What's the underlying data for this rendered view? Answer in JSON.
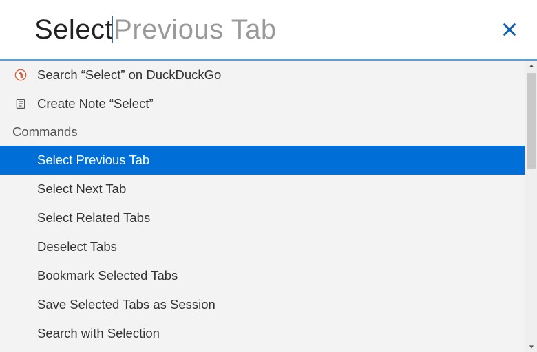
{
  "search": {
    "typed": "Select",
    "suggestion_remainder": " Previous Tab"
  },
  "close_label": "Close",
  "actions": [
    {
      "icon": "duckduckgo-icon",
      "label": "Search “Select” on DuckDuckGo"
    },
    {
      "icon": "note-icon",
      "label": "Create Note “Select”"
    }
  ],
  "section_label": "Commands",
  "commands": [
    {
      "label": "Select Previous Tab",
      "selected": true
    },
    {
      "label": "Select Next Tab"
    },
    {
      "label": "Select Related Tabs"
    },
    {
      "label": "Deselect Tabs"
    },
    {
      "label": "Bookmark Selected Tabs"
    },
    {
      "label": "Save Selected Tabs as Session"
    },
    {
      "label": "Search with Selection"
    }
  ],
  "colors": {
    "accent": "#006ed7",
    "separator": "#5aa0d8",
    "suggestion_text": "#9a9a9a"
  }
}
